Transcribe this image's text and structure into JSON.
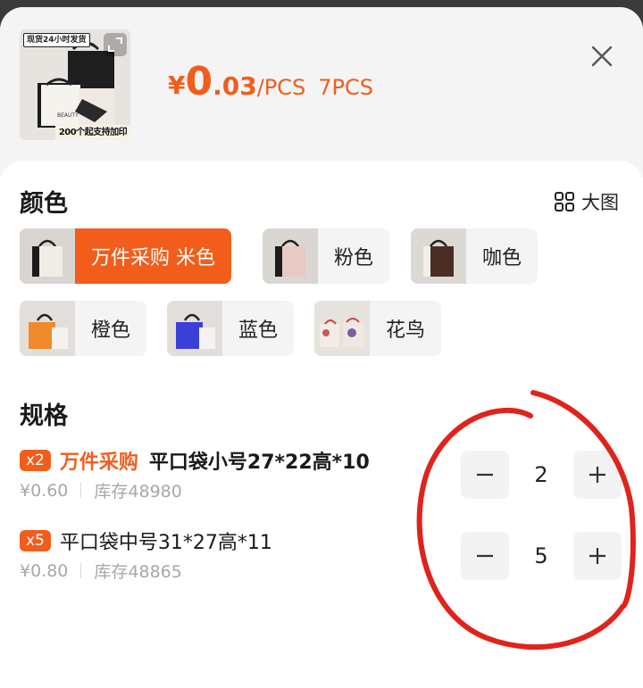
{
  "header": {
    "thumbnail": {
      "banner_text": "现货24小时发货",
      "footer_text": "200个起支持加印",
      "bag_text": "BEAUTY"
    },
    "price": {
      "currency": "¥",
      "integer": "0",
      "decimal": ".03",
      "unit": "/PCS",
      "total_qty": "7PCS"
    },
    "close_icon": "close-icon",
    "expand_icon": "expand-icon"
  },
  "colors_section": {
    "title": "颜色",
    "big_view_label": "大图",
    "big_view_icon": "grid-icon",
    "options": [
      {
        "label": "万件采购 米色",
        "selected": true,
        "swatch": "#f0ede6"
      },
      {
        "label": "粉色",
        "selected": false,
        "swatch": "#e8c9c4"
      },
      {
        "label": "咖色",
        "selected": false,
        "swatch": "#4a2e26"
      },
      {
        "label": "橙色",
        "selected": false,
        "swatch": "#f08a2a"
      },
      {
        "label": "蓝色",
        "selected": false,
        "swatch": "#3a3fd6"
      },
      {
        "label": "花鸟",
        "selected": false,
        "swatch": "#e6d8cf"
      }
    ]
  },
  "specs_section": {
    "title": "规格",
    "items": [
      {
        "badge": "x2",
        "promo": "万件采购",
        "name": "平口袋小号27*22高*10",
        "price": "¥0.60",
        "stock": "库存48980",
        "quantity": "2"
      },
      {
        "badge": "x5",
        "promo": "",
        "name": "平口袋中号31*27高*11",
        "price": "¥0.80",
        "stock": "库存48865",
        "quantity": "5"
      }
    ]
  },
  "colors": {
    "accent": "#f25d1c",
    "annotation": "#e0231b"
  }
}
